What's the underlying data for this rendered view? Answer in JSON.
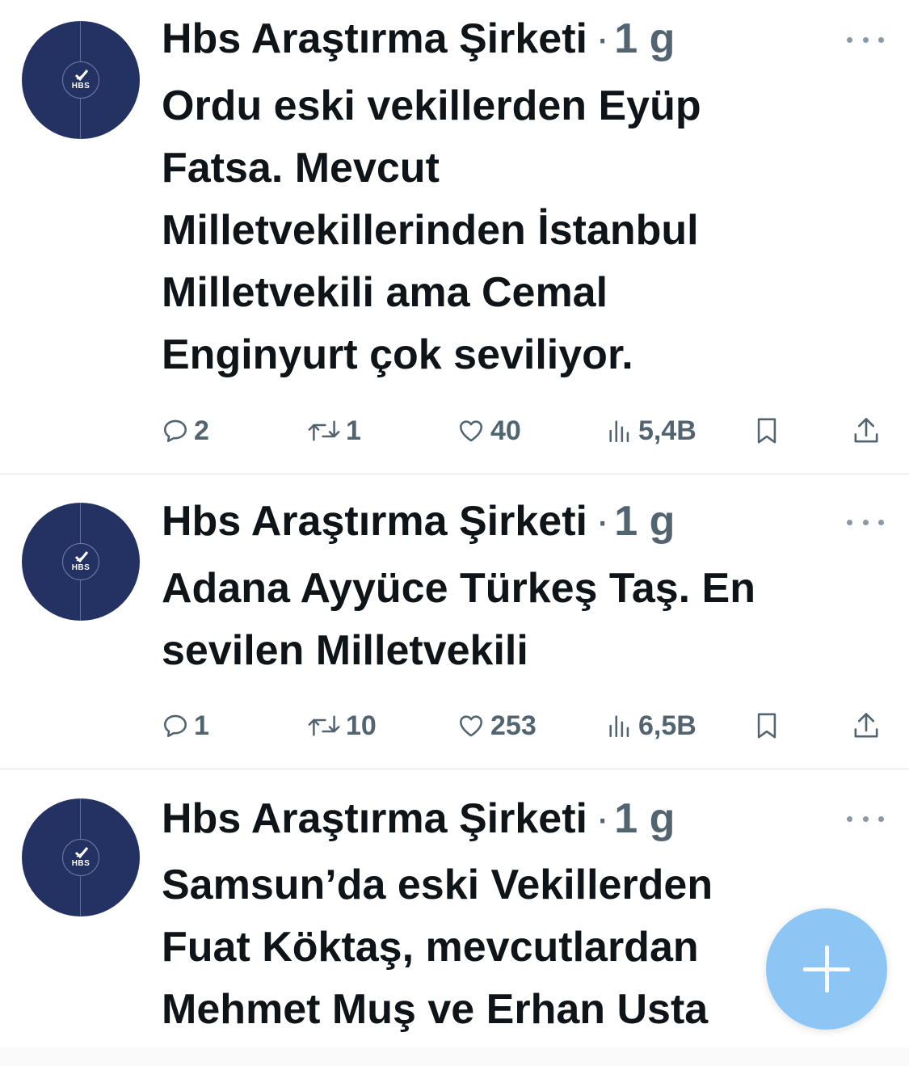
{
  "colors": {
    "accent": "#1d9bf0",
    "muted": "#536471",
    "avatar_bg": "#233262",
    "fab": "#7dbef3"
  },
  "tweets": [
    {
      "author": "Hbs Araştırma Şirketi",
      "separator": "·",
      "time": "1 g",
      "avatar_logo": "HBS",
      "text": "Ordu eski vekillerden Eyüp\nFatsa. Mevcut\nMilletvekillerinden İstanbul\nMilletvekili ama Cemal\nEnginyurt  çok seviliyor.",
      "replies": "2",
      "retweets": "1",
      "likes": "40",
      "views": "5,4B"
    },
    {
      "author": "Hbs Araştırma Şirketi",
      "separator": "·",
      "time": "1 g",
      "avatar_logo": "HBS",
      "text": "Adana Ayyüce Türkeş Taş. En\nsevilen Milletvekili",
      "replies": "1",
      "retweets": "10",
      "likes": "253",
      "views": "6,5B"
    },
    {
      "author": "Hbs Araştırma Şirketi",
      "separator": "·",
      "time": "1 g",
      "avatar_logo": "HBS",
      "text": "Samsun’da eski Vekillerden\nFuat Köktaş, mevcutlardan\nMehmet Muş ve Erhan Usta"
    }
  ],
  "icons": {
    "reply": "reply-icon",
    "retweet": "retweet-icon",
    "like": "heart-icon",
    "views": "views-icon",
    "bookmark": "bookmark-icon",
    "share": "share-icon",
    "more": "more-icon",
    "compose": "plus-icon"
  }
}
